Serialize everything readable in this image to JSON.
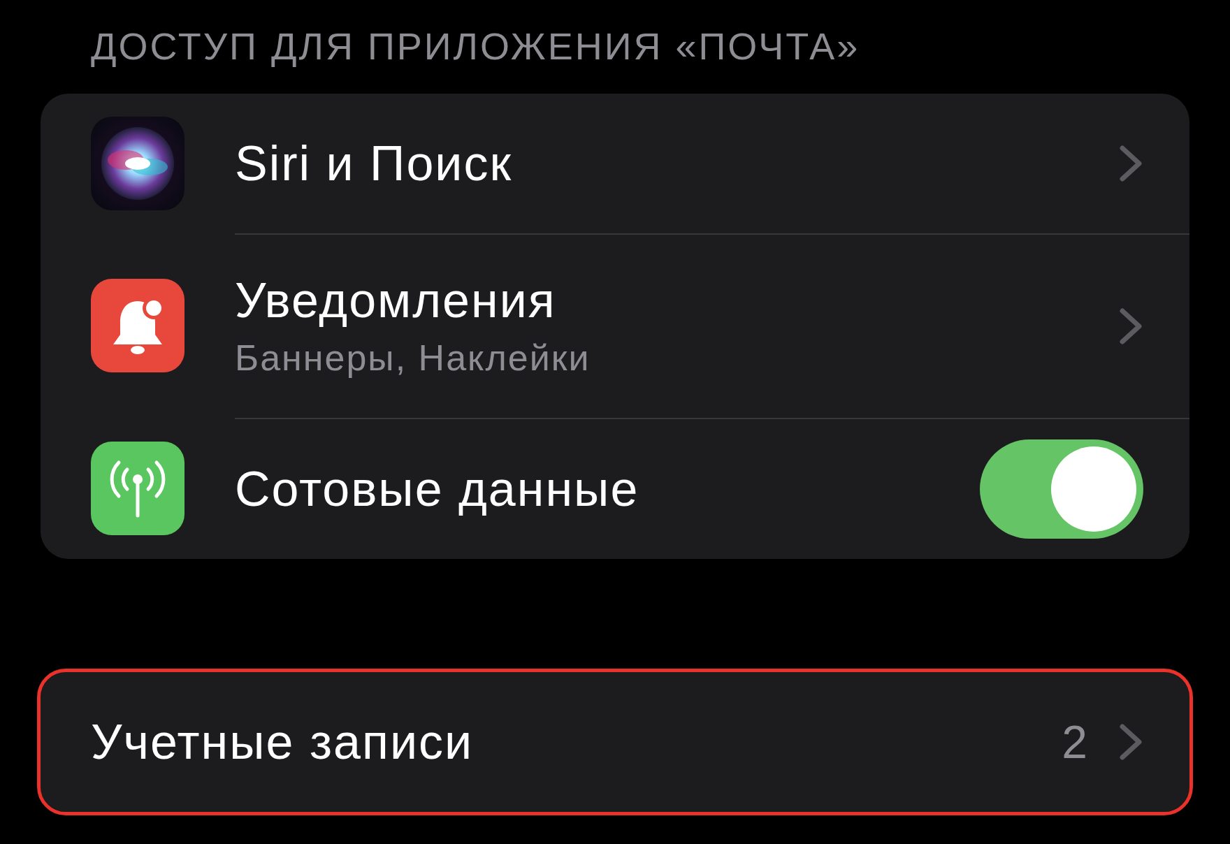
{
  "section_header": "ДОСТУП ДЛЯ ПРИЛОЖЕНИЯ «ПОЧТА»",
  "settings": [
    {
      "kind": "link",
      "title": "Siri и Поиск"
    },
    {
      "kind": "link",
      "title": "Уведомления",
      "subtitle": "Баннеры, Наклейки"
    },
    {
      "kind": "toggle",
      "title": "Сотовые данные",
      "on": true
    }
  ],
  "accounts": {
    "title": "Учетные записи",
    "value": "2",
    "highlighted": true
  }
}
